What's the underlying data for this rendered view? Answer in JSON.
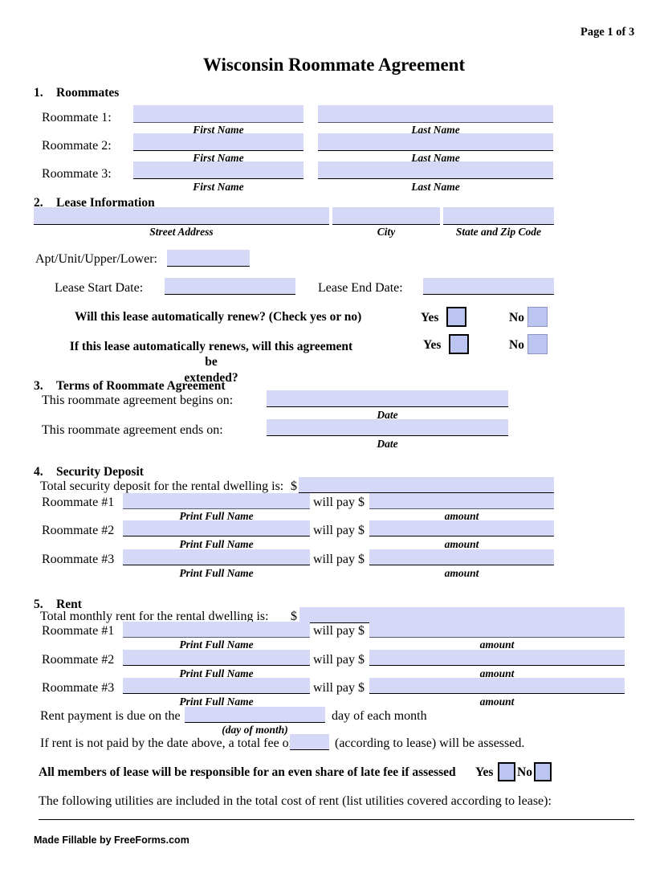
{
  "header": {
    "page_number": "Page 1 of 3",
    "title": "Wisconsin Roommate Agreement"
  },
  "sections": {
    "roommates": {
      "number": "1.",
      "heading": "Roommates",
      "rows": [
        {
          "label": "Roommate 1:",
          "first_value": "",
          "last_value": ""
        },
        {
          "label": "Roommate 2:",
          "first_value": "",
          "last_value": ""
        },
        {
          "label": "Roommate 3:",
          "first_value": "",
          "last_value": ""
        }
      ],
      "caption_first": "First Name",
      "caption_last": "Last Name"
    },
    "lease_information": {
      "number": "2.",
      "heading": "Lease Information",
      "street_value": "",
      "city_value": "",
      "state_zip_value": "",
      "caption_street": "Street Address",
      "caption_city": "City",
      "caption_state_zip": "State and Zip Code",
      "apt_label": "Apt/Unit/Upper/Lower:",
      "apt_value": "",
      "lease_start_label": "Lease Start Date:",
      "lease_start_value": "",
      "lease_end_label": "Lease End Date:",
      "lease_end_value": "",
      "renew_question": "Will this lease automatically renew? (Check yes or no)",
      "renew_yes_label": "Yes",
      "renew_no_label": "No",
      "extend_question_line1": "If this lease automatically renews, will this agreement be",
      "extend_question_line2": "extended?",
      "extend_yes_label": "Yes",
      "extend_no_label": "No"
    },
    "terms": {
      "number": "3.",
      "heading": "Terms of Roommate Agreement",
      "begins_label": "This roommate agreement begins on:",
      "begins_value": "",
      "begins_caption": "Date",
      "ends_label": "This roommate agreement ends on:",
      "ends_value": "",
      "ends_caption": "Date"
    },
    "security_deposit": {
      "number": "4.",
      "heading": "Security Deposit",
      "total_label": "Total security deposit for the rental dwelling is:",
      "dollar_sign": "$",
      "total_value": "",
      "will_pay_label": "will pay $",
      "caption_name": "Print Full Name",
      "caption_amount": "amount",
      "rows": [
        {
          "label": "Roommate #1",
          "name_value": "",
          "amount_value": ""
        },
        {
          "label": "Roommate #2",
          "name_value": "",
          "amount_value": ""
        },
        {
          "label": "Roommate #3",
          "name_value": "",
          "amount_value": ""
        }
      ]
    },
    "rent": {
      "number": "5.",
      "heading": "Rent",
      "total_label": "Total monthly rent for the rental dwelling is:",
      "dollar_sign": "$",
      "total_value": "",
      "will_pay_label": "will pay $",
      "caption_name": "Print Full Name",
      "caption_amount": "amount",
      "rows": [
        {
          "label": "Roommate #1",
          "name_value": "",
          "amount_value": ""
        },
        {
          "label": "Roommate #2",
          "name_value": "",
          "amount_value": ""
        },
        {
          "label": "Roommate #3",
          "name_value": "",
          "amount_value": ""
        }
      ],
      "due_label_before": "Rent payment is due on the",
      "due_value": "",
      "due_label_after": "day of each month",
      "due_caption": "(day of month)",
      "late_label_before": "If rent is not paid by the date above, a total fee of",
      "late_fee_value": "",
      "late_label_after": "(according to lease) will be assessed.",
      "even_share_label": "All members of lease will be responsible for an even share of late fee if assessed",
      "even_share_yes": "Yes",
      "even_share_no": "No",
      "utilities_label": "The following utilities are included in the total cost of rent (list utilities covered according to lease):",
      "utilities_value": ""
    }
  },
  "footer": {
    "credit": "Made Fillable by FreeForms.com"
  },
  "colors": {
    "field_fill": "#d5d9f7",
    "checkbox_fill": "#bcc4f2",
    "rule": "#000000",
    "text": "#000000"
  }
}
